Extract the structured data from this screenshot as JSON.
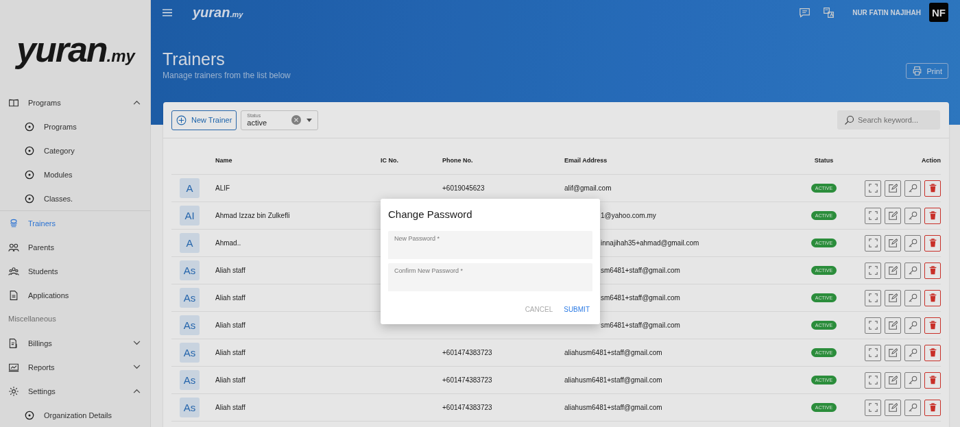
{
  "sidebar": {
    "logo": {
      "main": "yuran",
      "suffix": ".my"
    },
    "items": [
      {
        "kind": "group",
        "label": "Programs",
        "expanded": true,
        "selected": false,
        "children": [
          {
            "label": "Programs",
            "selected": false
          },
          {
            "label": "Category",
            "selected": false
          },
          {
            "label": "Modules",
            "selected": false
          },
          {
            "label": "Classes.",
            "selected": false
          }
        ]
      },
      {
        "kind": "link",
        "label": "Trainers",
        "selected": true
      },
      {
        "kind": "link",
        "label": "Parents",
        "selected": false
      },
      {
        "kind": "link",
        "label": "Students",
        "selected": false
      },
      {
        "kind": "link",
        "label": "Applications",
        "selected": false
      },
      {
        "kind": "section",
        "label": "Miscellaneous"
      },
      {
        "kind": "group",
        "label": "Billings",
        "expanded": false,
        "selected": false
      },
      {
        "kind": "group",
        "label": "Reports",
        "expanded": false,
        "selected": false
      },
      {
        "kind": "group",
        "label": "Settings",
        "expanded": true,
        "selected": false,
        "children": [
          {
            "label": "Organization Details",
            "selected": false
          }
        ]
      }
    ]
  },
  "topbar": {
    "logo": {
      "main": "yuran",
      "suffix": ".my"
    },
    "user": "NUR FATIN NAJIHAH",
    "avatar": "NF"
  },
  "page": {
    "title": "Trainers",
    "subtitle": "Manage trainers from the list below",
    "print": "Print"
  },
  "toolbar": {
    "new_button": "New Trainer",
    "status_filter": {
      "label": "Status",
      "value": "active"
    },
    "search": {
      "placeholder": "Search keyword..."
    }
  },
  "table": {
    "columns": [
      "Name",
      "IC No.",
      "Phone No.",
      "Email Address",
      "Status",
      "Action"
    ],
    "rows": [
      {
        "initials": "A",
        "name": "ALIF",
        "phone": "+6019045623",
        "email": "alif@gmail.com",
        "status": "ACTIVE"
      },
      {
        "initials": "AI",
        "name": "Ahmad Izzaz bin Zulkefli",
        "email": "1@yahoo.com.my",
        "status": "ACTIVE"
      },
      {
        "initials": "A",
        "name": "Ahmad..",
        "email": "innajihah35+ahmad@gmail.com",
        "status": "ACTIVE"
      },
      {
        "initials": "As",
        "name": "Aliah staff",
        "email": "sm6481+staff@gmail.com",
        "status": "ACTIVE"
      },
      {
        "initials": "As",
        "name": "Aliah staff",
        "email": "sm6481+staff@gmail.com",
        "status": "ACTIVE"
      },
      {
        "initials": "As",
        "name": "Aliah staff",
        "email": "sm6481+staff@gmail.com",
        "status": "ACTIVE"
      },
      {
        "initials": "As",
        "name": "Aliah staff",
        "phone": "+601474383723",
        "email": "aliahusm6481+staff@gmail.com",
        "status": "ACTIVE"
      },
      {
        "initials": "As",
        "name": "Aliah staff",
        "phone": "+601474383723",
        "email": "aliahusm6481+staff@gmail.com",
        "status": "ACTIVE"
      },
      {
        "initials": "As",
        "name": "Aliah staff",
        "phone": "+601474383723",
        "email": "aliahusm6481+staff@gmail.com",
        "status": "ACTIVE"
      }
    ]
  },
  "dialog": {
    "title": "Change Password",
    "fields": [
      {
        "placeholder": "New Password *"
      },
      {
        "placeholder": "Confirm New Password *"
      }
    ],
    "buttons": [
      {
        "label": "CANCEL",
        "kind": "secondary"
      },
      {
        "label": "SUBMIT",
        "kind": "primary"
      }
    ]
  }
}
